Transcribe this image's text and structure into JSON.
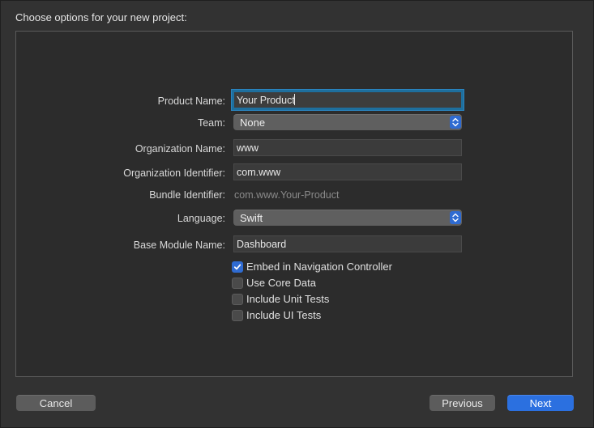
{
  "header": {
    "title": "Choose options for your new project:"
  },
  "form": {
    "product_name": {
      "label": "Product Name:",
      "value": "Your Product"
    },
    "team": {
      "label": "Team:",
      "value": "None"
    },
    "organization_name": {
      "label": "Organization Name:",
      "value": "www"
    },
    "organization_identifier": {
      "label": "Organization Identifier:",
      "value": "com.www"
    },
    "bundle_identifier": {
      "label": "Bundle Identifier:",
      "value": "com.www.Your-Product"
    },
    "language": {
      "label": "Language:",
      "value": "Swift"
    },
    "base_module_name": {
      "label": "Base Module Name:",
      "value": "Dashboard"
    },
    "checkboxes": [
      {
        "label": "Embed in Navigation Controller",
        "checked": true
      },
      {
        "label": "Use Core Data",
        "checked": false
      },
      {
        "label": "Include Unit Tests",
        "checked": false
      },
      {
        "label": "Include UI Tests",
        "checked": false
      }
    ]
  },
  "footer": {
    "cancel_label": "Cancel",
    "previous_label": "Previous",
    "next_label": "Next"
  },
  "colors": {
    "accent": "#2b70e0",
    "focus_ring": "#1e6f9e",
    "background": "#323232"
  },
  "icons": {
    "popup": "chevron-up-down-icon",
    "checkmark": "checkmark-icon"
  }
}
